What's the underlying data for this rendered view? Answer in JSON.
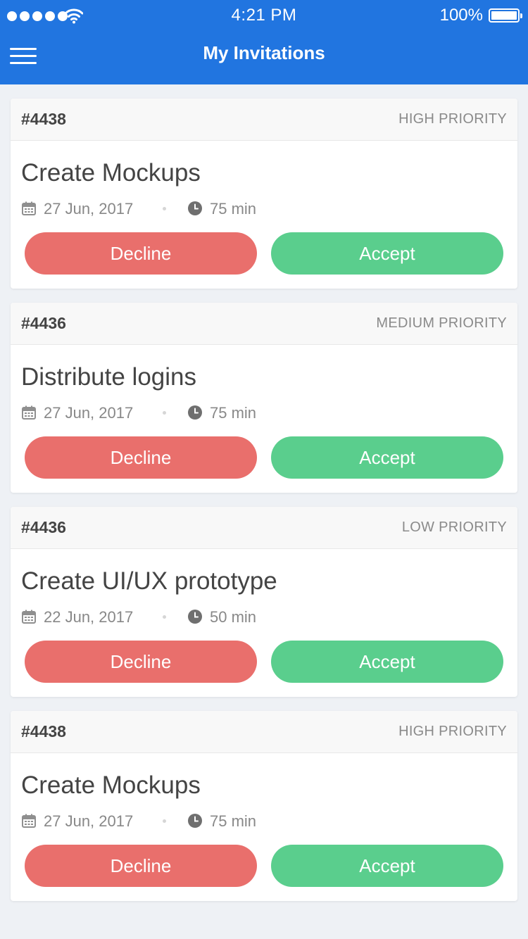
{
  "status_bar": {
    "time": "4:21 PM",
    "battery": "100%"
  },
  "header": {
    "title": "My Invitations"
  },
  "invitations": [
    {
      "id": "#4438",
      "priority": "HIGH PRIORITY",
      "title": "Create Mockups",
      "date": "27 Jun, 2017",
      "duration": "75 min",
      "decline_label": "Decline",
      "accept_label": "Accept"
    },
    {
      "id": "#4436",
      "priority": "MEDIUM PRIORITY",
      "title": "Distribute logins",
      "date": "27 Jun, 2017",
      "duration": "75 min",
      "decline_label": "Decline",
      "accept_label": "Accept"
    },
    {
      "id": "#4436",
      "priority": "LOW PRIORITY",
      "title": "Create UI/UX prototype",
      "date": "22 Jun, 2017",
      "duration": "50 min",
      "decline_label": "Decline",
      "accept_label": "Accept"
    },
    {
      "id": "#4438",
      "priority": "HIGH PRIORITY",
      "title": "Create Mockups",
      "date": "27 Jun, 2017",
      "duration": "75 min",
      "decline_label": "Decline",
      "accept_label": "Accept"
    }
  ],
  "colors": {
    "header": "#2175e0",
    "decline": "#e96f6c",
    "accept": "#5ace8d",
    "background": "#eef1f5"
  },
  "icons": {
    "menu": "hamburger-menu-icon",
    "date": "calendar-icon",
    "duration": "clock-icon",
    "signal": "signal-icon",
    "wifi": "wifi-icon",
    "battery": "battery-icon"
  }
}
